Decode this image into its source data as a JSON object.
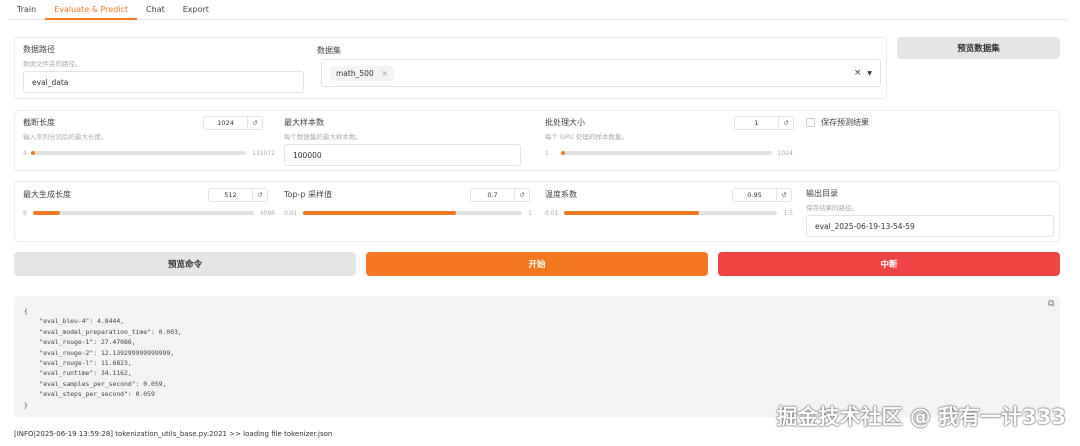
{
  "tabs": [
    "Train",
    "Evaluate & Predict",
    "Chat",
    "Export"
  ],
  "dataset_dir": {
    "label": "数据路径",
    "desc": "数据文件夹的路径。",
    "value": "eval_data"
  },
  "dataset": {
    "label": "数据集",
    "selected": "math_500",
    "clear": "×",
    "remove": "×"
  },
  "preview_dataset": "预览数据集",
  "cutoff_len": {
    "label": "截断长度",
    "desc": "输入序列分词后的最大长度。",
    "value": "1024",
    "min": "4",
    "max": "131072",
    "fraction": 0.008
  },
  "max_samples": {
    "label": "最大样本数",
    "desc": "每个数据集的最大样本数。",
    "value": "100000"
  },
  "batch_size": {
    "label": "批处理大小",
    "desc": "每个 GPU 处理的样本数量。",
    "value": "1",
    "min": "1",
    "max": "1024",
    "fraction": 0
  },
  "predict": {
    "label": "保存预测结果",
    "checked": false
  },
  "max_new_tokens": {
    "label": "最大生成长度",
    "value": "512",
    "min": "8",
    "max": "4096",
    "fraction": 0.125
  },
  "top_p": {
    "label": "Top-p 采样值",
    "value": "0.7",
    "min": "0.01",
    "max": "1",
    "fraction": 0.697
  },
  "temperature": {
    "label": "温度系数",
    "value": "0.95",
    "min": "0.01",
    "max": "1.5",
    "fraction": 0.631
  },
  "output_dir": {
    "label": "输出目录",
    "desc": "保存结果的路径。",
    "value": "eval_2025-06-19-13-54-59"
  },
  "buttons": {
    "preview_cmd": "预览命令",
    "start": "开始",
    "abort": "中断"
  },
  "output": "{\n    \"eval_bleu-4\": 4.8444,\n    \"eval_model_preparation_time\": 0.003,\n    \"eval_rouge-1\": 27.47086,\n    \"eval_rouge-2\": 12.139299999999999,\n    \"eval_rouge-l\": 11.6823,\n    \"eval_runtime\": 34.1162,\n    \"eval_samples_per_second\": 0.059,\n    \"eval_steps_per_second\": 0.059\n}",
  "log": "[INFO|2025-06-19 13:59:28] tokenization_utils_base.py:2021 >> loading file tokenizer.json",
  "watermark": "掘金技术社区 @ 我有一计333",
  "colors": {
    "accent": "#f07a22",
    "stop": "#ef4444"
  }
}
